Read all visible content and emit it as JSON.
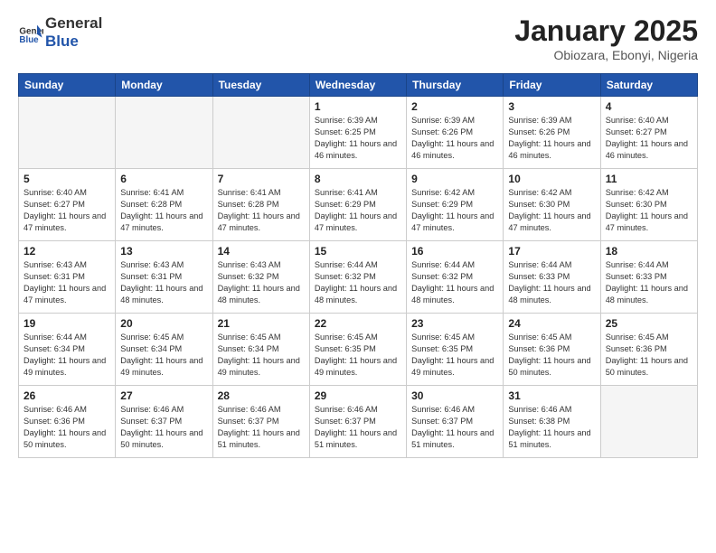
{
  "header": {
    "logo_general": "General",
    "logo_blue": "Blue",
    "title": "January 2025",
    "location": "Obiozara, Ebonyi, Nigeria"
  },
  "weekdays": [
    "Sunday",
    "Monday",
    "Tuesday",
    "Wednesday",
    "Thursday",
    "Friday",
    "Saturday"
  ],
  "weeks": [
    [
      {
        "day": "",
        "sunrise": "",
        "sunset": "",
        "daylight": "",
        "empty": true
      },
      {
        "day": "",
        "sunrise": "",
        "sunset": "",
        "daylight": "",
        "empty": true
      },
      {
        "day": "",
        "sunrise": "",
        "sunset": "",
        "daylight": "",
        "empty": true
      },
      {
        "day": "1",
        "sunrise": "Sunrise: 6:39 AM",
        "sunset": "Sunset: 6:25 PM",
        "daylight": "Daylight: 11 hours and 46 minutes.",
        "empty": false
      },
      {
        "day": "2",
        "sunrise": "Sunrise: 6:39 AM",
        "sunset": "Sunset: 6:26 PM",
        "daylight": "Daylight: 11 hours and 46 minutes.",
        "empty": false
      },
      {
        "day": "3",
        "sunrise": "Sunrise: 6:39 AM",
        "sunset": "Sunset: 6:26 PM",
        "daylight": "Daylight: 11 hours and 46 minutes.",
        "empty": false
      },
      {
        "day": "4",
        "sunrise": "Sunrise: 6:40 AM",
        "sunset": "Sunset: 6:27 PM",
        "daylight": "Daylight: 11 hours and 46 minutes.",
        "empty": false
      }
    ],
    [
      {
        "day": "5",
        "sunrise": "Sunrise: 6:40 AM",
        "sunset": "Sunset: 6:27 PM",
        "daylight": "Daylight: 11 hours and 47 minutes.",
        "empty": false
      },
      {
        "day": "6",
        "sunrise": "Sunrise: 6:41 AM",
        "sunset": "Sunset: 6:28 PM",
        "daylight": "Daylight: 11 hours and 47 minutes.",
        "empty": false
      },
      {
        "day": "7",
        "sunrise": "Sunrise: 6:41 AM",
        "sunset": "Sunset: 6:28 PM",
        "daylight": "Daylight: 11 hours and 47 minutes.",
        "empty": false
      },
      {
        "day": "8",
        "sunrise": "Sunrise: 6:41 AM",
        "sunset": "Sunset: 6:29 PM",
        "daylight": "Daylight: 11 hours and 47 minutes.",
        "empty": false
      },
      {
        "day": "9",
        "sunrise": "Sunrise: 6:42 AM",
        "sunset": "Sunset: 6:29 PM",
        "daylight": "Daylight: 11 hours and 47 minutes.",
        "empty": false
      },
      {
        "day": "10",
        "sunrise": "Sunrise: 6:42 AM",
        "sunset": "Sunset: 6:30 PM",
        "daylight": "Daylight: 11 hours and 47 minutes.",
        "empty": false
      },
      {
        "day": "11",
        "sunrise": "Sunrise: 6:42 AM",
        "sunset": "Sunset: 6:30 PM",
        "daylight": "Daylight: 11 hours and 47 minutes.",
        "empty": false
      }
    ],
    [
      {
        "day": "12",
        "sunrise": "Sunrise: 6:43 AM",
        "sunset": "Sunset: 6:31 PM",
        "daylight": "Daylight: 11 hours and 47 minutes.",
        "empty": false
      },
      {
        "day": "13",
        "sunrise": "Sunrise: 6:43 AM",
        "sunset": "Sunset: 6:31 PM",
        "daylight": "Daylight: 11 hours and 48 minutes.",
        "empty": false
      },
      {
        "day": "14",
        "sunrise": "Sunrise: 6:43 AM",
        "sunset": "Sunset: 6:32 PM",
        "daylight": "Daylight: 11 hours and 48 minutes.",
        "empty": false
      },
      {
        "day": "15",
        "sunrise": "Sunrise: 6:44 AM",
        "sunset": "Sunset: 6:32 PM",
        "daylight": "Daylight: 11 hours and 48 minutes.",
        "empty": false
      },
      {
        "day": "16",
        "sunrise": "Sunrise: 6:44 AM",
        "sunset": "Sunset: 6:32 PM",
        "daylight": "Daylight: 11 hours and 48 minutes.",
        "empty": false
      },
      {
        "day": "17",
        "sunrise": "Sunrise: 6:44 AM",
        "sunset": "Sunset: 6:33 PM",
        "daylight": "Daylight: 11 hours and 48 minutes.",
        "empty": false
      },
      {
        "day": "18",
        "sunrise": "Sunrise: 6:44 AM",
        "sunset": "Sunset: 6:33 PM",
        "daylight": "Daylight: 11 hours and 48 minutes.",
        "empty": false
      }
    ],
    [
      {
        "day": "19",
        "sunrise": "Sunrise: 6:44 AM",
        "sunset": "Sunset: 6:34 PM",
        "daylight": "Daylight: 11 hours and 49 minutes.",
        "empty": false
      },
      {
        "day": "20",
        "sunrise": "Sunrise: 6:45 AM",
        "sunset": "Sunset: 6:34 PM",
        "daylight": "Daylight: 11 hours and 49 minutes.",
        "empty": false
      },
      {
        "day": "21",
        "sunrise": "Sunrise: 6:45 AM",
        "sunset": "Sunset: 6:34 PM",
        "daylight": "Daylight: 11 hours and 49 minutes.",
        "empty": false
      },
      {
        "day": "22",
        "sunrise": "Sunrise: 6:45 AM",
        "sunset": "Sunset: 6:35 PM",
        "daylight": "Daylight: 11 hours and 49 minutes.",
        "empty": false
      },
      {
        "day": "23",
        "sunrise": "Sunrise: 6:45 AM",
        "sunset": "Sunset: 6:35 PM",
        "daylight": "Daylight: 11 hours and 49 minutes.",
        "empty": false
      },
      {
        "day": "24",
        "sunrise": "Sunrise: 6:45 AM",
        "sunset": "Sunset: 6:36 PM",
        "daylight": "Daylight: 11 hours and 50 minutes.",
        "empty": false
      },
      {
        "day": "25",
        "sunrise": "Sunrise: 6:45 AM",
        "sunset": "Sunset: 6:36 PM",
        "daylight": "Daylight: 11 hours and 50 minutes.",
        "empty": false
      }
    ],
    [
      {
        "day": "26",
        "sunrise": "Sunrise: 6:46 AM",
        "sunset": "Sunset: 6:36 PM",
        "daylight": "Daylight: 11 hours and 50 minutes.",
        "empty": false
      },
      {
        "day": "27",
        "sunrise": "Sunrise: 6:46 AM",
        "sunset": "Sunset: 6:37 PM",
        "daylight": "Daylight: 11 hours and 50 minutes.",
        "empty": false
      },
      {
        "day": "28",
        "sunrise": "Sunrise: 6:46 AM",
        "sunset": "Sunset: 6:37 PM",
        "daylight": "Daylight: 11 hours and 51 minutes.",
        "empty": false
      },
      {
        "day": "29",
        "sunrise": "Sunrise: 6:46 AM",
        "sunset": "Sunset: 6:37 PM",
        "daylight": "Daylight: 11 hours and 51 minutes.",
        "empty": false
      },
      {
        "day": "30",
        "sunrise": "Sunrise: 6:46 AM",
        "sunset": "Sunset: 6:37 PM",
        "daylight": "Daylight: 11 hours and 51 minutes.",
        "empty": false
      },
      {
        "day": "31",
        "sunrise": "Sunrise: 6:46 AM",
        "sunset": "Sunset: 6:38 PM",
        "daylight": "Daylight: 11 hours and 51 minutes.",
        "empty": false
      },
      {
        "day": "",
        "sunrise": "",
        "sunset": "",
        "daylight": "",
        "empty": true
      }
    ]
  ]
}
